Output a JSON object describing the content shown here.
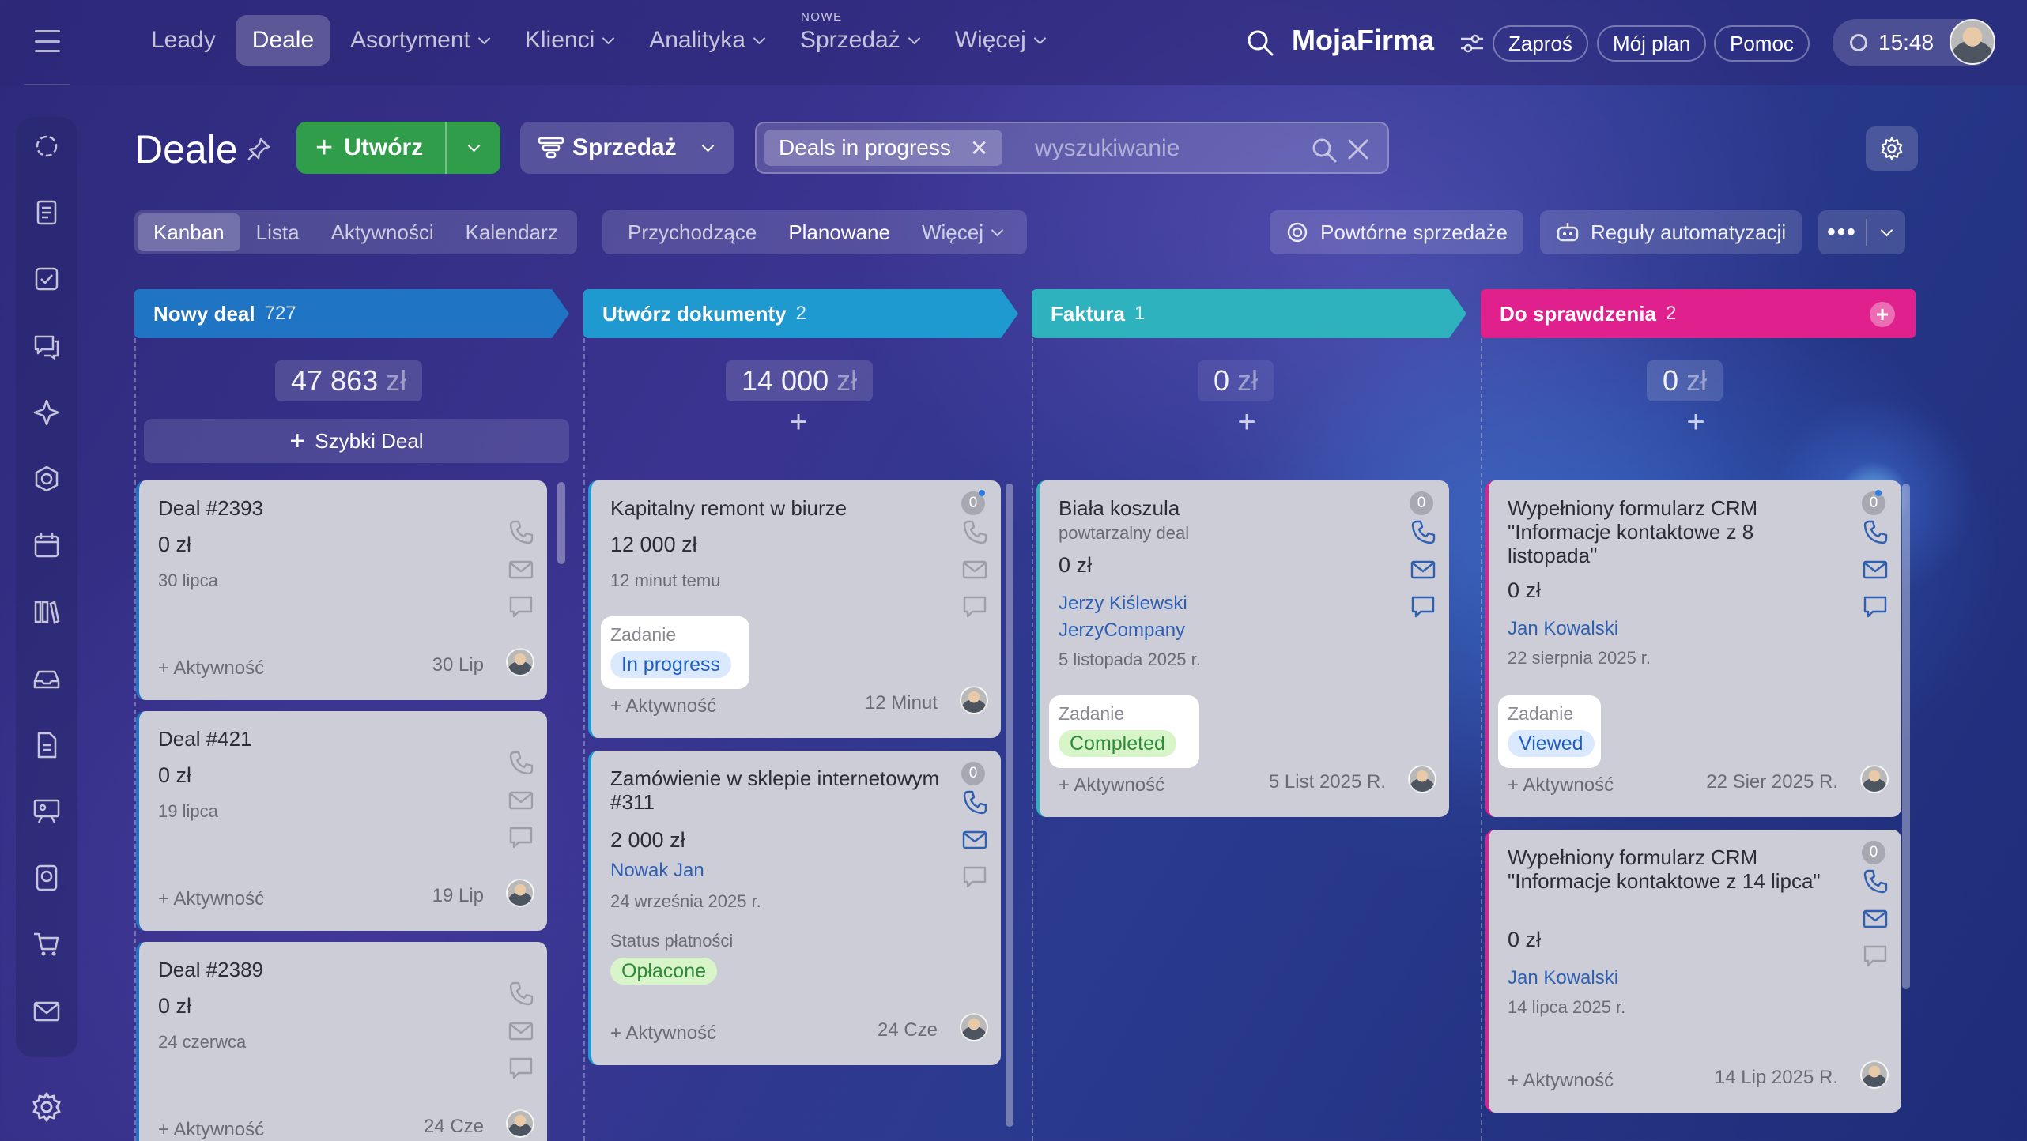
{
  "app": {
    "brand": "MojaFirma",
    "time": "15:48"
  },
  "nav": {
    "items": [
      {
        "label": "Leady",
        "has_menu": false
      },
      {
        "label": "Deale",
        "has_menu": false,
        "active": true
      },
      {
        "label": "Asortyment",
        "has_menu": true
      },
      {
        "label": "Klienci",
        "has_menu": true
      },
      {
        "label": "Analityka",
        "has_menu": true
      },
      {
        "label": "Sprzedaż",
        "has_menu": true,
        "badge": "NOWE"
      },
      {
        "label": "Więcej",
        "has_menu": true
      }
    ],
    "invite": "Zaproś",
    "my_plan": "Mój plan",
    "help": "Pomoc"
  },
  "sidebar": {
    "icons": [
      "crm-icon",
      "documents-icon",
      "tasks-icon",
      "chat-icon",
      "ai-star-icon",
      "hexagon-icon",
      "calendar-icon",
      "library-icon",
      "inbox-icon",
      "file-icon",
      "presentation-icon",
      "passport-icon",
      "cart-icon",
      "mail-icon"
    ],
    "settings_icon": "gear-icon"
  },
  "toolbar": {
    "title": "Deale",
    "create_label": "Utwórz",
    "funnel_label": "Sprzedaż",
    "filter_chip": "Deals in progress",
    "search_placeholder": "wyszukiwanie"
  },
  "views": {
    "tabs": [
      {
        "label": "Kanban",
        "active": true
      },
      {
        "label": "Lista"
      },
      {
        "label": "Aktywności"
      },
      {
        "label": "Kalendarz"
      }
    ],
    "filters": [
      {
        "label": "Przychodzące"
      },
      {
        "label": "Planowane",
        "strong": true
      },
      {
        "label": "Więcej"
      }
    ],
    "repeat_sales": "Powtórne sprzedaże",
    "automation": "Reguły automatyzacji"
  },
  "colors": {
    "stage_new": "#1f74c4",
    "stage_docs": "#1f9ad0",
    "stage_invoice": "#2eb2be",
    "stage_review": "#e0208d",
    "create_green": "#2f9d4a",
    "badge_progress_bg": "#dbe9ff",
    "badge_completed_bg": "#d8f5c9",
    "badge_viewed_bg": "#dbe9ff"
  },
  "columns": [
    {
      "name": "Nowy deal",
      "count": "727",
      "sum_value": "47 863",
      "currency": "zł",
      "quick_deal": "Szybki Deal",
      "cards": [
        {
          "title": "Deal #2393",
          "amount": "0 zł",
          "date": "30 lipca",
          "activity": "+ Aktywność",
          "when": "30 Lip"
        },
        {
          "title": "Deal #421",
          "amount": "0 zł",
          "date": "19 lipca",
          "activity": "+ Aktywność",
          "when": "19 Lip"
        },
        {
          "title": "Deal #2389",
          "amount": "0 zł",
          "date": "24 czerwca",
          "activity": "+ Aktywność",
          "when": "24 Cze"
        }
      ]
    },
    {
      "name": "Utwórz dokumenty",
      "count": "2",
      "sum_value": "14 000",
      "currency": "zł",
      "cards": [
        {
          "title": "Kapitalny remont w biurze",
          "amount": "12 000 zł",
          "date": "12 minut temu",
          "task_label": "Zadanie",
          "task_status": "In progress",
          "activity": "+ Aktywność",
          "when": "12 Minut",
          "counter": "0"
        },
        {
          "title": "Zamówienie w sklepie internetowym #311",
          "amount": "2 000 zł",
          "contact": "Nowak Jan",
          "date": "24 września 2025 r.",
          "payment_label": "Status płatności",
          "payment_status": "Opłacone",
          "activity": "+ Aktywność",
          "when": "24 Cze",
          "counter": "0"
        }
      ]
    },
    {
      "name": "Faktura",
      "count": "1",
      "sum_value": "0",
      "currency": "zł",
      "cards": [
        {
          "title": "Biała koszula",
          "subtitle": "powtarzalny deal",
          "amount": "0 zł",
          "contact": "Jerzy Kiślewski",
          "company": "JerzyCompany",
          "date": "5 listopada 2025 r.",
          "task_label": "Zadanie",
          "task_status": "Completed",
          "activity": "+ Aktywność",
          "when": "5 List 2025 R.",
          "counter": "0"
        }
      ]
    },
    {
      "name": "Do sprawdzenia",
      "count": "2",
      "sum_value": "0",
      "currency": "zł",
      "cards": [
        {
          "title": "Wypełniony formularz CRM \"Informacje kontaktowe z 8 listopada\"",
          "amount": "0 zł",
          "contact": "Jan Kowalski",
          "date": "22 sierpnia 2025 r.",
          "task_label": "Zadanie",
          "task_status": "Viewed",
          "activity": "+ Aktywność",
          "when": "22 Sier 2025 R.",
          "counter": "0"
        },
        {
          "title": "Wypełniony formularz CRM \"Informacje kontaktowe z 14 lipca\"",
          "amount": "0 zł",
          "contact": "Jan Kowalski",
          "date": "14 lipca 2025 r.",
          "activity": "+ Aktywność",
          "when": "14 Lip 2025 R.",
          "counter": "0"
        }
      ]
    }
  ]
}
